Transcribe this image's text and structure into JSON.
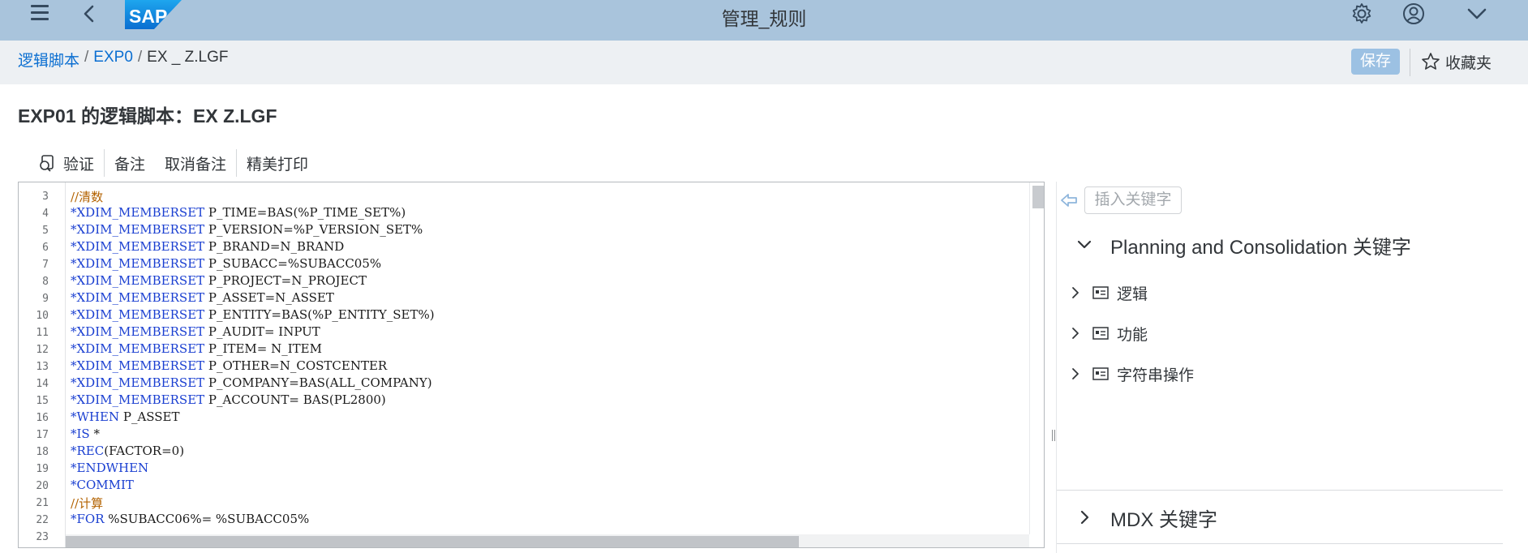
{
  "shell": {
    "title": "管理_规则",
    "logo_text": "SAP"
  },
  "breadcrumb": {
    "items": [
      "逻辑脚本",
      "EXP0",
      "EX _ Z.LGF"
    ]
  },
  "header": {
    "save_label": "保存",
    "favorites_label": "收藏夹",
    "page_title": "EXP01 的逻辑脚本：EX Z.LGF"
  },
  "toolbar": {
    "validate_label": "验证",
    "comment_label": "备注",
    "uncomment_label": "取消备注",
    "pretty_print_label": "精美打印"
  },
  "editor": {
    "line_numbers": [
      "3",
      "4",
      "5",
      "6",
      "7",
      "8",
      "9",
      "10",
      "11",
      "12",
      "13",
      "14",
      "15",
      "16",
      "17",
      "18",
      "19",
      "20",
      "21",
      "22",
      "23"
    ],
    "lines": [
      {
        "kw": "",
        "text": "",
        "cm": "//清数"
      },
      {
        "kw": "*XDIM_MEMBERSET",
        "text": " P_TIME=BAS(%P_TIME_SET%)",
        "cm": ""
      },
      {
        "kw": "*XDIM_MEMBERSET",
        "text": " P_VERSION=%P_VERSION_SET%",
        "cm": ""
      },
      {
        "kw": "*XDIM_MEMBERSET",
        "text": " P_BRAND=N_BRAND",
        "cm": ""
      },
      {
        "kw": "*XDIM_MEMBERSET",
        "text": " P_SUBACC=%SUBACC05%",
        "cm": ""
      },
      {
        "kw": "*XDIM_MEMBERSET",
        "text": " P_PROJECT=N_PROJECT",
        "cm": ""
      },
      {
        "kw": "*XDIM_MEMBERSET",
        "text": " P_ASSET=N_ASSET",
        "cm": ""
      },
      {
        "kw": "*XDIM_MEMBERSET",
        "text": " P_ENTITY=BAS(%P_ENTITY_SET%)",
        "cm": ""
      },
      {
        "kw": "*XDIM_MEMBERSET",
        "text": " P_AUDIT= INPUT",
        "cm": ""
      },
      {
        "kw": "*XDIM_MEMBERSET",
        "text": " P_ITEM= N_ITEM",
        "cm": ""
      },
      {
        "kw": "*XDIM_MEMBERSET",
        "text": " P_OTHER=N_COSTCENTER",
        "cm": ""
      },
      {
        "kw": "*XDIM_MEMBERSET",
        "text": " P_COMPANY=BAS(ALL_COMPANY)",
        "cm": ""
      },
      {
        "kw": "*XDIM_MEMBERSET",
        "text": " P_ACCOUNT= BAS(PL2800)",
        "cm": ""
      },
      {
        "kw": "*WHEN",
        "text": " P_ASSET",
        "cm": ""
      },
      {
        "kw": "*IS",
        "text": " *",
        "cm": ""
      },
      {
        "kw": "*REC",
        "text": "(FACTOR=0)",
        "cm": ""
      },
      {
        "kw": "*ENDWHEN",
        "text": "",
        "cm": ""
      },
      {
        "kw": "*COMMIT",
        "text": "",
        "cm": ""
      },
      {
        "kw": "",
        "text": "",
        "cm": "//计算"
      },
      {
        "kw": "*FOR",
        "text": " %SUBACC06%= %SUBACC05%",
        "cm": ""
      },
      {
        "kw": "",
        "text": "",
        "cm": ""
      }
    ]
  },
  "panel": {
    "insert_keyword_label": "插入关键字",
    "section_bpc": "Planning and Consolidation 关键字",
    "tree_items": [
      "逻辑",
      "功能",
      "字符串操作"
    ],
    "section_mdx": "MDX 关键字"
  },
  "colors": {
    "shell_bg": "#a9c4dc",
    "link": "#0a6ed1",
    "keyword": "#1a3fd1",
    "comment": "#b36200"
  }
}
